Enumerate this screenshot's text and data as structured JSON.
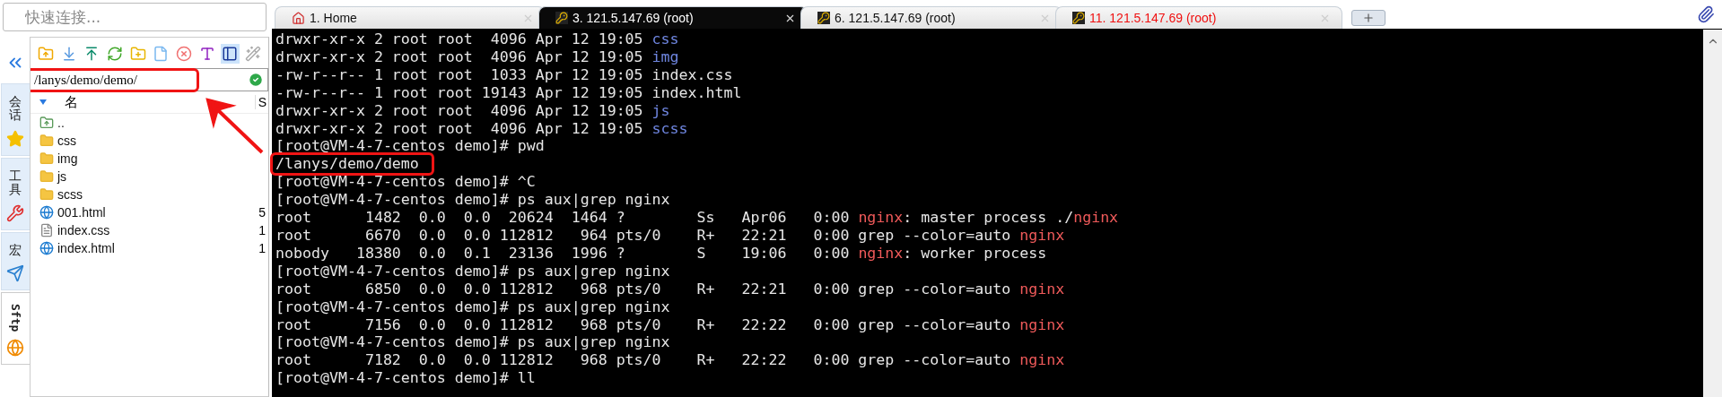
{
  "quick_connect": {
    "placeholder": "快速连接..."
  },
  "side_tabs": [
    {
      "label": "会话",
      "kind": "star",
      "selected": false
    },
    {
      "label": "工具",
      "kind": "tool",
      "selected": false
    },
    {
      "label": "宏",
      "kind": "send",
      "selected": false
    },
    {
      "label": "Sftp",
      "kind": "globe",
      "selected": true
    }
  ],
  "sftp": {
    "path": {
      "value": "/lanys/demo/demo/",
      "annotated": true
    },
    "columns": [
      "名",
      "S"
    ],
    "files": [
      {
        "name": "..",
        "kind": "parent"
      },
      {
        "name": "css",
        "kind": "folder"
      },
      {
        "name": "img",
        "kind": "folder"
      },
      {
        "name": "js",
        "kind": "folder"
      },
      {
        "name": "scss",
        "kind": "folder"
      },
      {
        "name": "001.html",
        "kind": "html",
        "size": "5"
      },
      {
        "name": "index.css",
        "kind": "css",
        "size": "1"
      },
      {
        "name": "index.html",
        "kind": "html",
        "size": "1"
      }
    ]
  },
  "tabs": [
    {
      "label": "1. Home",
      "kind": "home",
      "selected": false,
      "disconnected": false
    },
    {
      "label": "3. 121.5.147.69 (root)",
      "kind": "session",
      "selected": true,
      "disconnected": false
    },
    {
      "label": "6. 121.5.147.69 (root)",
      "kind": "session",
      "selected": false,
      "disconnected": false
    },
    {
      "label": "11. 121.5.147.69 (root)",
      "kind": "session",
      "selected": false,
      "disconnected": true
    }
  ],
  "terminal": {
    "lines": [
      {
        "segments": [
          {
            "text": "drwxr-xr-x 2 root root  4096 Apr 12 19:05 ",
            "kind": "plain"
          },
          {
            "text": "css",
            "kind": "dir"
          }
        ]
      },
      {
        "segments": [
          {
            "text": "drwxr-xr-x 2 root root  4096 Apr 12 19:05 ",
            "kind": "plain"
          },
          {
            "text": "img",
            "kind": "dir"
          }
        ]
      },
      {
        "segments": [
          {
            "text": "-rw-r--r-- 1 root root  1033 Apr 12 19:05 index.css",
            "kind": "plain"
          }
        ]
      },
      {
        "segments": [
          {
            "text": "-rw-r--r-- 1 root root 19143 Apr 12 19:05 index.html",
            "kind": "plain"
          }
        ]
      },
      {
        "segments": [
          {
            "text": "drwxr-xr-x 2 root root  4096 Apr 12 19:05 ",
            "kind": "plain"
          },
          {
            "text": "js",
            "kind": "dir"
          }
        ]
      },
      {
        "segments": [
          {
            "text": "drwxr-xr-x 2 root root  4096 Apr 12 19:05 ",
            "kind": "plain"
          },
          {
            "text": "scss",
            "kind": "dir"
          }
        ]
      },
      {
        "segments": [
          {
            "text": "[root@VM-4-7-centos demo]# pwd",
            "kind": "plain"
          }
        ]
      },
      {
        "annotated": true,
        "segments": [
          {
            "text": "/lanys/demo/demo",
            "kind": "plain"
          }
        ]
      },
      {
        "segments": [
          {
            "text": "[root@VM-4-7-centos demo]# ^C",
            "kind": "plain"
          }
        ]
      },
      {
        "segments": [
          {
            "text": "[root@VM-4-7-centos demo]# ps aux|grep nginx",
            "kind": "plain"
          }
        ]
      },
      {
        "segments": [
          {
            "text": "root      1482  0.0  0.0  20624  1464 ?        Ss   Apr06   0:00 ",
            "kind": "plain"
          },
          {
            "text": "nginx",
            "kind": "match"
          },
          {
            "text": ": master process ./",
            "kind": "plain"
          },
          {
            "text": "nginx",
            "kind": "match"
          }
        ]
      },
      {
        "segments": [
          {
            "text": "root      6670  0.0  0.0 112812   964 pts/0    R+   22:21   0:00 grep --color=auto ",
            "kind": "plain"
          },
          {
            "text": "nginx",
            "kind": "match"
          }
        ]
      },
      {
        "segments": [
          {
            "text": "nobody   18380  0.0  0.1  23136  1996 ?        S    19:06   0:00 ",
            "kind": "plain"
          },
          {
            "text": "nginx",
            "kind": "match"
          },
          {
            "text": ": worker process",
            "kind": "plain"
          }
        ]
      },
      {
        "segments": [
          {
            "text": "[root@VM-4-7-centos demo]# ps aux|grep nginx",
            "kind": "plain"
          }
        ]
      },
      {
        "segments": [
          {
            "text": "root      6850  0.0  0.0 112812   968 pts/0    R+   22:21   0:00 grep --color=auto ",
            "kind": "plain"
          },
          {
            "text": "nginx",
            "kind": "match"
          }
        ]
      },
      {
        "segments": [
          {
            "text": "[root@VM-4-7-centos demo]# ps aux|grep nginx",
            "kind": "plain"
          }
        ]
      },
      {
        "segments": [
          {
            "text": "root      7156  0.0  0.0 112812   968 pts/0    R+   22:22   0:00 grep --color=auto ",
            "kind": "plain"
          },
          {
            "text": "nginx",
            "kind": "match"
          }
        ]
      },
      {
        "segments": [
          {
            "text": "[root@VM-4-7-centos demo]# ps aux|grep nginx",
            "kind": "plain"
          }
        ]
      },
      {
        "segments": [
          {
            "text": "root      7182  0.0  0.0 112812   968 pts/0    R+   22:22   0:00 grep --color=auto ",
            "kind": "plain"
          },
          {
            "text": "nginx",
            "kind": "match"
          }
        ]
      },
      {
        "segments": [
          {
            "text": "[root@VM-4-7-centos demo]# ll",
            "kind": "plain"
          }
        ]
      }
    ]
  }
}
